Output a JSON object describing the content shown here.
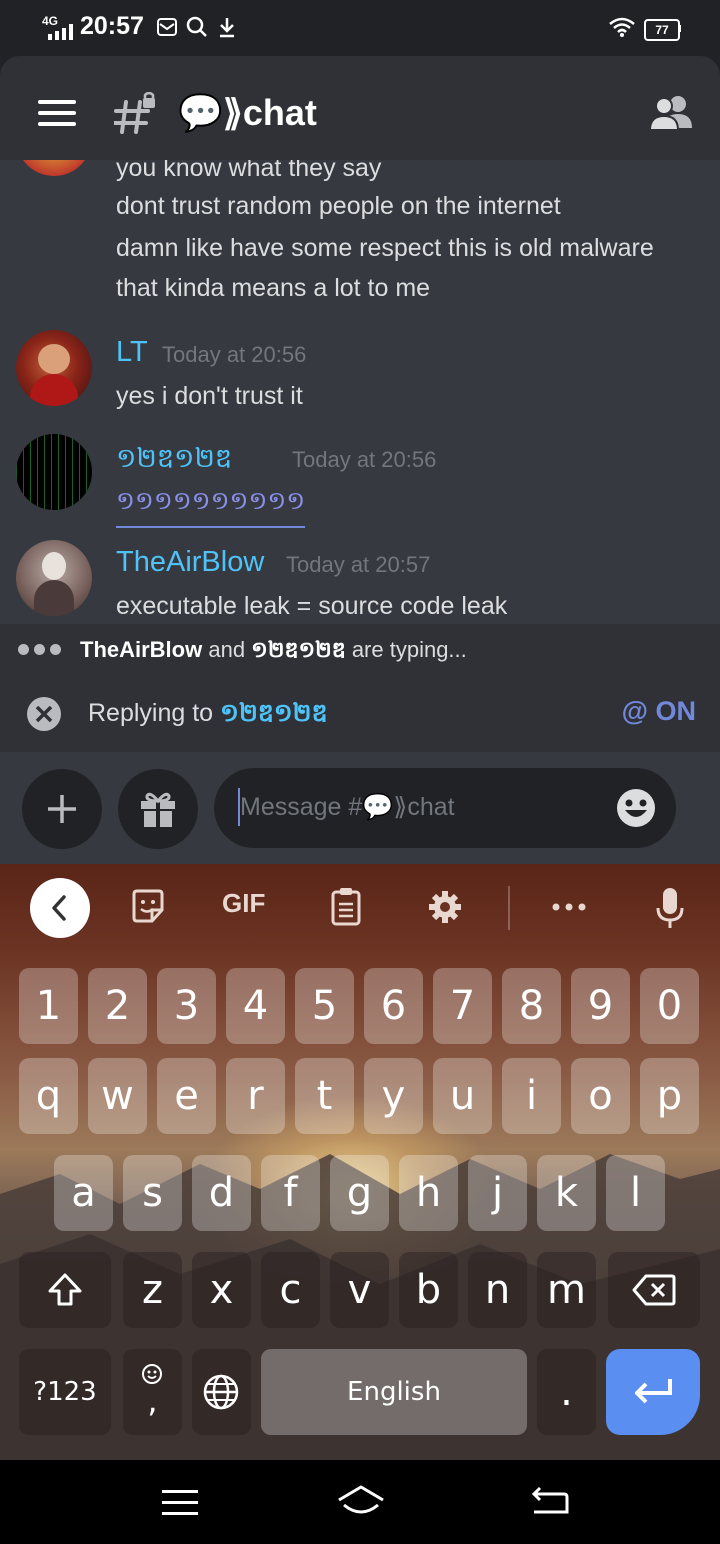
{
  "status_bar": {
    "network": "4G",
    "time": "20:57",
    "battery": "77"
  },
  "header": {
    "channel_title": "💬⟫chat",
    "icons": [
      "menu-icon",
      "locked-channel-icon",
      "members-icon"
    ]
  },
  "messages": {
    "continued_lines": [
      "you know what they say",
      "dont trust random people on the internet",
      "damn like have some respect this is old malware",
      "that kinda means a lot to me"
    ],
    "groups": [
      {
        "author": "LT",
        "timestamp": "Today at 20:56",
        "text": "yes i don't trust it"
      },
      {
        "author": "១២ឌ១២ឌ",
        "timestamp": "Today at 20:56",
        "text": "១១១១១១១១១១"
      },
      {
        "author": "TheAirBlow",
        "timestamp": "Today at 20:57",
        "text": "executable leak = source code leak"
      }
    ]
  },
  "typing_indicator": {
    "user1": "TheAirBlow",
    "and": " and ",
    "user2": "១២ឌ១២ឌ",
    "suffix": " are typing..."
  },
  "reply_bar": {
    "prefix": "Replying to ",
    "target": "១២ឌ១២ឌ",
    "mention_toggle": "@ ON"
  },
  "composer": {
    "placeholder": "Message #💬⟫chat"
  },
  "keyboard": {
    "toolbar": [
      "back-icon",
      "sticker-icon",
      "GIF",
      "clipboard-icon",
      "settings-icon",
      "more-icon",
      "mic-icon"
    ],
    "gif_label": "GIF",
    "row_numbers": [
      "1",
      "2",
      "3",
      "4",
      "5",
      "6",
      "7",
      "8",
      "9",
      "0"
    ],
    "row1": [
      "q",
      "w",
      "e",
      "r",
      "t",
      "y",
      "u",
      "i",
      "o",
      "p"
    ],
    "row2": [
      "a",
      "s",
      "d",
      "f",
      "g",
      "h",
      "j",
      "k",
      "l"
    ],
    "row3": [
      "z",
      "x",
      "c",
      "v",
      "b",
      "n",
      "m"
    ],
    "sym_key": "?123",
    "comma_key": ",",
    "space_label": "English",
    "period_key": "."
  },
  "colors": {
    "accent_blue": "#4fc3f7",
    "blurple": "#7289da",
    "enter_key": "#5a8ef0"
  }
}
